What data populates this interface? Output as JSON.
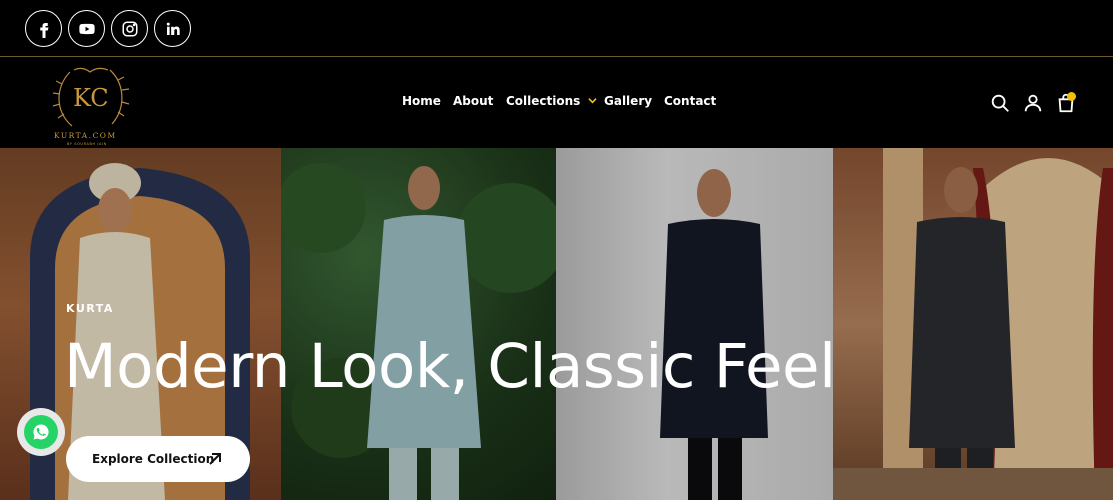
{
  "social": {
    "icons": [
      "facebook-icon",
      "youtube-icon",
      "instagram-icon",
      "linkedin-icon"
    ]
  },
  "brand": {
    "monogram": "KC",
    "name": "KURTA.COM",
    "tagline": "BY SOURABH JAIN"
  },
  "nav": {
    "home": "Home",
    "about": "About",
    "collections": "Collections",
    "gallery": "Gallery",
    "contact": "Contact"
  },
  "hero": {
    "eyebrow": "KURTA",
    "headline": "Modern Look, Classic Feel",
    "cta_label": "Explore Collection"
  },
  "colors": {
    "accent": "#f2c200",
    "background": "#000000",
    "whatsapp": "#25d366"
  }
}
